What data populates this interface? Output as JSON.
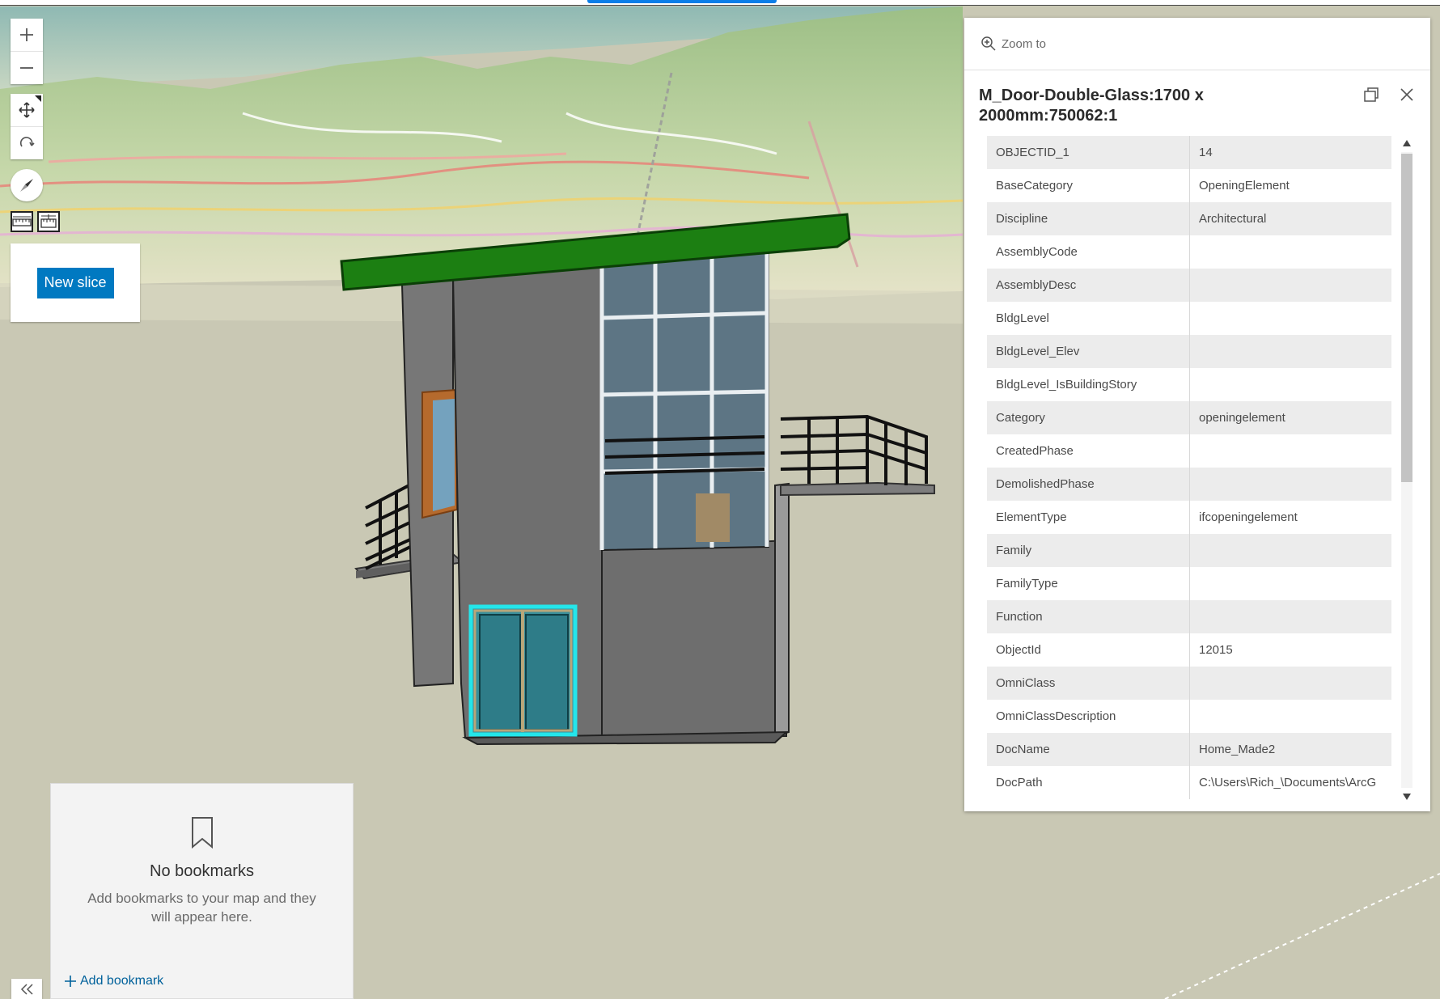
{
  "toolbar": {
    "zoom_in": "zoom-in",
    "zoom_out": "zoom-out"
  },
  "slice": {
    "button_label": "New slice"
  },
  "bookmarks": {
    "title": "No bookmarks",
    "description": "Add bookmarks to your map and they will appear here.",
    "add_label": "Add bookmark"
  },
  "popup": {
    "zoom_label": "Zoom to",
    "title": "M_Door-Double-Glass:1700 x 2000mm:750062:1",
    "attributes": [
      {
        "key": "OBJECTID_1",
        "value": "14"
      },
      {
        "key": "BaseCategory",
        "value": "OpeningElement"
      },
      {
        "key": "Discipline",
        "value": "Architectural"
      },
      {
        "key": "AssemblyCode",
        "value": ""
      },
      {
        "key": "AssemblyDesc",
        "value": ""
      },
      {
        "key": "BldgLevel",
        "value": ""
      },
      {
        "key": "BldgLevel_Elev",
        "value": ""
      },
      {
        "key": "BldgLevel_IsBuildingStory",
        "value": ""
      },
      {
        "key": "Category",
        "value": "openingelement"
      },
      {
        "key": "CreatedPhase",
        "value": ""
      },
      {
        "key": "DemolishedPhase",
        "value": ""
      },
      {
        "key": "ElementType",
        "value": "ifcopeningelement"
      },
      {
        "key": "Family",
        "value": ""
      },
      {
        "key": "FamilyType",
        "value": ""
      },
      {
        "key": "Function",
        "value": ""
      },
      {
        "key": "ObjectId",
        "value": "12015"
      },
      {
        "key": "OmniClass",
        "value": ""
      },
      {
        "key": "OmniClassDescription",
        "value": ""
      },
      {
        "key": "DocName",
        "value": "Home_Made2"
      },
      {
        "key": "DocPath",
        "value": "C:\\Users\\Rich_\\Documents\\ArcG"
      }
    ]
  },
  "colors": {
    "accent": "#0079c1",
    "roof": "#1c7f12",
    "selection": "#24e6ea",
    "ground": "#c9c8b4"
  }
}
